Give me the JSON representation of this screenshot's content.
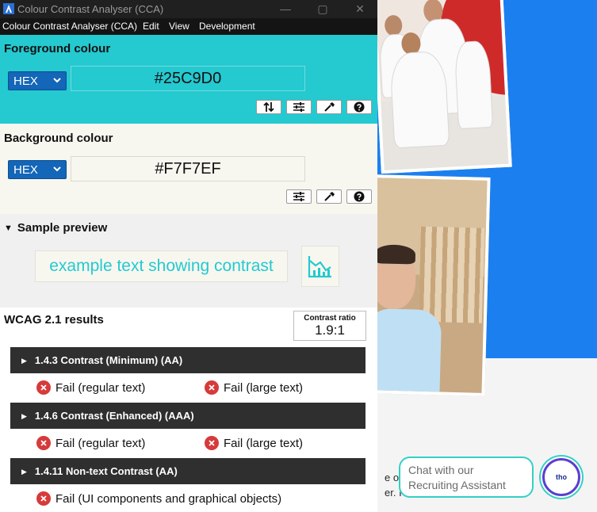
{
  "app": {
    "window_title": "Colour Contrast Analyser (CCA)",
    "window_controls": {
      "minimize": "—",
      "maximize": "▢",
      "close": "✕"
    },
    "menu": [
      "Colour Contrast Analyser (CCA)",
      "Edit",
      "View",
      "Development"
    ]
  },
  "foreground": {
    "title": "Foreground colour",
    "format": "HEX",
    "value": "#25C9D0",
    "color": "#25C9D0",
    "tools": [
      "swap-icon",
      "sliders-icon",
      "eyedropper-icon",
      "help-icon"
    ]
  },
  "background": {
    "title": "Background colour",
    "format": "HEX",
    "value": "#F7F7EF",
    "color": "#F7F7EF",
    "tools": [
      "sliders-icon",
      "eyedropper-icon",
      "help-icon"
    ]
  },
  "preview": {
    "title": "Sample preview",
    "sample_text": "example text showing contrast"
  },
  "results": {
    "title": "WCAG 2.1 results",
    "ratio_label": "Contrast ratio",
    "ratio_value": "1.9:1",
    "criteria": [
      {
        "label": "1.4.3 Contrast (Minimum) (AA)",
        "results": [
          "Fail (regular text)",
          "Fail (large text)"
        ]
      },
      {
        "label": "1.4.6 Contrast (Enhanced) (AAA)",
        "results": [
          "Fail (regular text)",
          "Fail (large text)"
        ]
      },
      {
        "label": "1.4.11 Non-text Contrast (AA)",
        "results": [
          "Fail (UI components and graphical objects)"
        ]
      }
    ]
  },
  "website": {
    "partial_text_1": "e of",
    "partial_text_2": "er. I",
    "chat_text": "Chat with our Recruiting Assistant",
    "avatar_text": "tho"
  },
  "colors": {
    "fail": "#D63A3A",
    "menubar": "#141414",
    "criteria_bar": "#2F2F2F",
    "select": "#1366B8",
    "site_blue": "#1B7FF0"
  }
}
